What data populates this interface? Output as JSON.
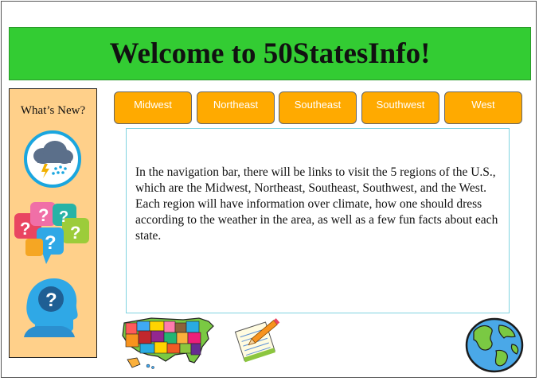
{
  "header": {
    "title": "Welcome to 50StatesInfo!"
  },
  "sidebar": {
    "title": "What’s New?",
    "icons": [
      "weather-icon",
      "question-bubbles-icon",
      "thinking-head-icon"
    ]
  },
  "nav": {
    "items": [
      {
        "label": "Midwest"
      },
      {
        "label": "Northeast"
      },
      {
        "label": "Southeast"
      },
      {
        "label": "Southwest"
      },
      {
        "label": "West"
      }
    ]
  },
  "main": {
    "description": "In the navigation bar, there will be links to visit the 5 regions of the U.S., which are the Midwest, Northeast, Southeast, Southwest, and the West. Each region will have information over climate, how one should dress according to the weather in the area, as well as a few fun facts about each state."
  },
  "colors": {
    "header_bg": "#33cc33",
    "nav_button": "#ffaa00",
    "sidebar_bg": "#ffd08a"
  }
}
